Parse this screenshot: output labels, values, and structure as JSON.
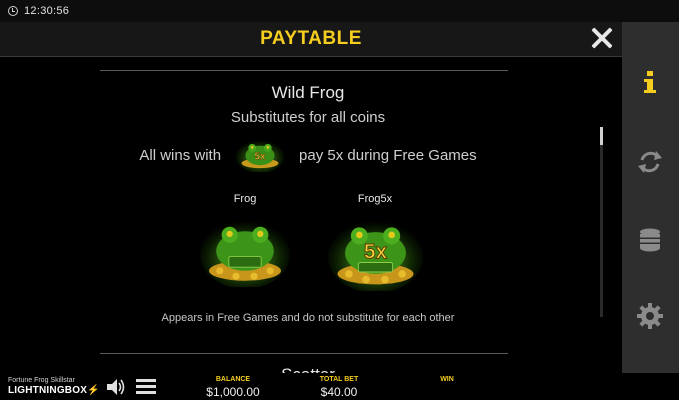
{
  "status_bar": {
    "time": "12:30:56"
  },
  "header": {
    "title": "PAYTABLE"
  },
  "section": {
    "title": "Wild Frog",
    "subtitle": "Substitutes for all coins",
    "wins_prefix": "All wins with",
    "wins_suffix": "pay 5x during Free Games",
    "symbols": [
      {
        "label": "Frog"
      },
      {
        "label": "Frog5x"
      }
    ],
    "note": "Appears in Free Games and do not substitute for each other",
    "next_title": "Scatter"
  },
  "sidebar": {
    "items": [
      {
        "icon": "info-icon"
      },
      {
        "icon": "refresh-icon"
      },
      {
        "icon": "coins-icon"
      },
      {
        "icon": "gear-icon"
      }
    ]
  },
  "bottom_bar": {
    "game_name": "Fortune Frog Skillstar",
    "brand": "LIGHTNINGBOX",
    "balance_label": "BALANCE",
    "balance_value": "$1,000.00",
    "total_bet_label": "TOTAL BET",
    "total_bet_value": "$40.00",
    "win_label": "WIN"
  },
  "colors": {
    "accent": "#f5cd1f",
    "frog_green": "#3fae1e",
    "sidebar_bg": "#2e2e2e"
  }
}
